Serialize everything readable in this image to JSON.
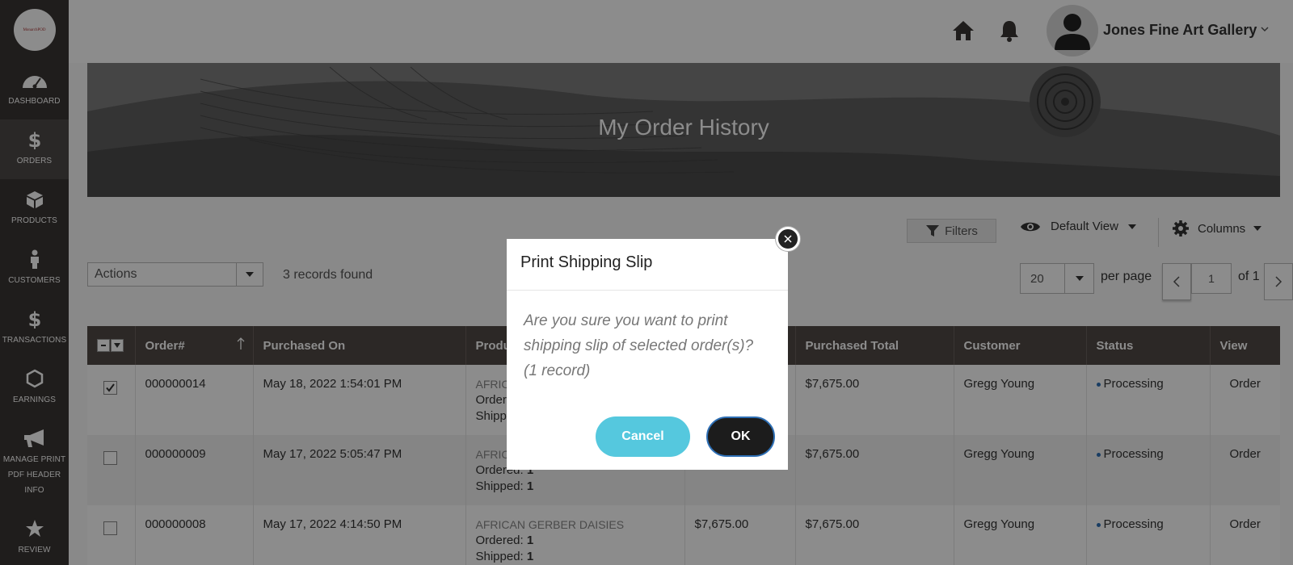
{
  "sidebar": {
    "logo_text": "MonarchPOD",
    "items": [
      {
        "label": "DASHBOARD",
        "icon": "dashboard-gauge-icon"
      },
      {
        "label": "ORDERS",
        "icon": "dollar-icon"
      },
      {
        "label": "PRODUCTS",
        "icon": "box-icon"
      },
      {
        "label": "CUSTOMERS",
        "icon": "person-icon"
      },
      {
        "label": "TRANSACTIONS",
        "icon": "dollar-icon"
      },
      {
        "label": "EARNINGS",
        "icon": "hexagon-icon"
      },
      {
        "label": "MANAGE PRINT PDF HEADER INFO",
        "lines": [
          "MANAGE PRINT",
          "PDF HEADER",
          "INFO"
        ],
        "icon": "megaphone-icon"
      },
      {
        "label": "REVIEW",
        "icon": "star-icon"
      }
    ]
  },
  "header": {
    "account_name": "Jones Fine Art Gallery"
  },
  "banner": {
    "title": "My Order History"
  },
  "toolbar": {
    "filters_label": "Filters",
    "view_label": "Default View",
    "columns_label": "Columns",
    "actions_placeholder": "Actions",
    "records_found": "3 records found",
    "per_page_value": "20",
    "per_page_label": "per page",
    "current_page": "1",
    "page_of": "of 1"
  },
  "table": {
    "headers": [
      "Order#",
      "Purchased On",
      "Produ",
      "",
      "Purchased Total",
      "Customer",
      "Status",
      "View"
    ],
    "rows": [
      {
        "checked": true,
        "order": "000000014",
        "purchased_on": "May 18, 2022 1:54:01 PM",
        "product": "AFRIC",
        "ordered_label": "Order",
        "ordered_qty": "",
        "shipped_label": "Shipp",
        "shipped_qty": "",
        "price": "",
        "total": "$7,675.00",
        "customer": "Gregg Young",
        "status": "Processing",
        "view": "Order"
      },
      {
        "checked": false,
        "order": "000000009",
        "purchased_on": "May 17, 2022 5:05:47 PM",
        "product": "AFRIC",
        "ordered_label": "Ordered:",
        "ordered_qty": "1",
        "shipped_label": "Shipped:",
        "shipped_qty": "1",
        "price": "",
        "total": "$7,675.00",
        "customer": "Gregg Young",
        "status": "Processing",
        "view": "Order"
      },
      {
        "checked": false,
        "order": "000000008",
        "purchased_on": "May 17, 2022 4:14:50 PM",
        "product": "AFRICAN GERBER DAISIES",
        "ordered_label": "Ordered:",
        "ordered_qty": "1",
        "shipped_label": "Shipped:",
        "shipped_qty": "1",
        "price": "$7,675.00",
        "total": "$7,675.00",
        "customer": "Gregg Young",
        "status": "Processing",
        "view": "Order"
      }
    ]
  },
  "modal": {
    "title": "Print Shipping Slip",
    "message_lines": [
      "Are you sure you want to print",
      "shipping slip of selected order(s)?",
      "(1 record)"
    ],
    "cancel_label": "Cancel",
    "ok_label": "OK"
  },
  "colors": {
    "sidebar_bg": "#3a3633",
    "table_header_bg": "#514a45",
    "cancel_button": "#55c8de",
    "ok_button": "#1c1c1c",
    "link": "#2e6fb5"
  }
}
